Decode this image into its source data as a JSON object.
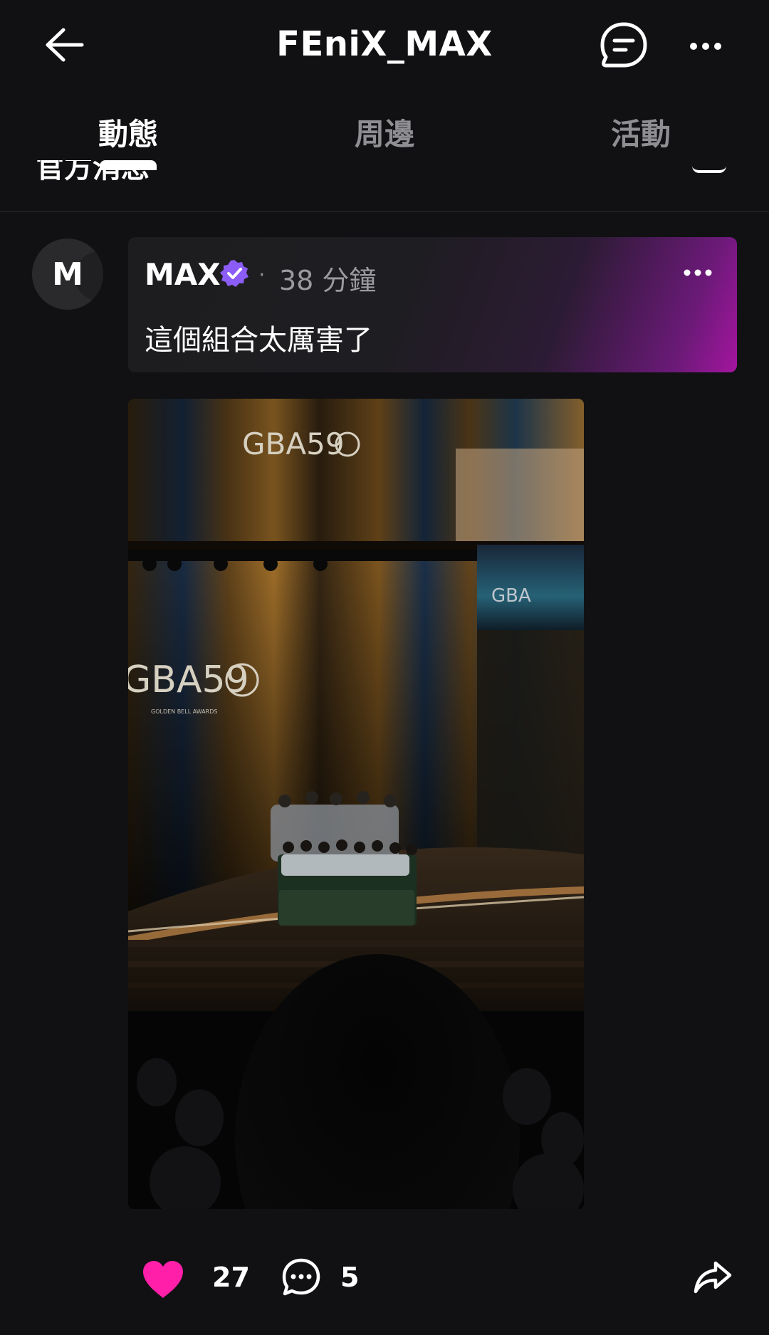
{
  "header": {
    "title": "FEniX_MAX",
    "icons": {
      "back": "arrow-left-icon",
      "chat": "chat-bubble-icon",
      "more": "more-horizontal-icon"
    }
  },
  "tabs": [
    {
      "label": "動態",
      "active": true
    },
    {
      "label": "周邊",
      "active": false
    },
    {
      "label": "活動",
      "active": false
    }
  ],
  "peek": {
    "text": "官方消息"
  },
  "post": {
    "avatar_initial": "M",
    "author": "MAX",
    "verified": true,
    "separator": "·",
    "time": "38 分鐘",
    "text": "這個組合太厲害了",
    "image": {
      "stage_logo_top": "GBA59",
      "stage_logo_left": "GBA59",
      "stage_logo_sub": "GOLDEN BELL AWARDS",
      "stage_logo_right": "GBA"
    },
    "likes": "27",
    "comments": "5",
    "liked": true
  },
  "colors": {
    "background": "#111113",
    "like_accent": "#ff1fa8",
    "verified_badge": "#8b5cf6",
    "card_gradient_end": "#a4159f"
  }
}
